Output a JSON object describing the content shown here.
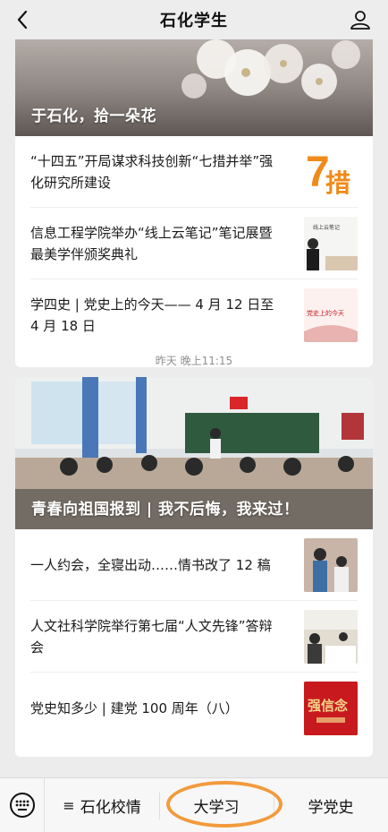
{
  "header": {
    "title": "石化学生"
  },
  "card1": {
    "hero_caption": "于石化，拾一朵花",
    "items": [
      {
        "text": "“十四五”开局谋求科技创新“七措并举”强化研究所建设",
        "thumb_text": "措"
      },
      {
        "text": "信息工程学院举办“线上云笔记”笔记展暨最美学伴颁奖典礼",
        "thumb_text": "线上云笔记"
      },
      {
        "text": "学四史 | 党史上的今天—— 4 月 12 日至 4 月 18 日",
        "thumb_text": "党史上的今天"
      }
    ]
  },
  "timestamp": "昨天 晚上11:15",
  "card2": {
    "hero_caption": "青春向祖国报到 | 我不后悔，我来过！",
    "items": [
      {
        "text": "一人约会，全寝出动……情书改了 12 稿"
      },
      {
        "text": "人文社科学院举行第七届“人文先锋”答辩会"
      },
      {
        "text": "党史知多少 | 建党 100 周年（八）",
        "thumb_text": "强信念"
      }
    ]
  },
  "bottom_menu": {
    "items": [
      {
        "label": "石化校情",
        "has_submenu": true
      },
      {
        "label": "大学习",
        "has_submenu": false
      },
      {
        "label": "学党史",
        "has_submenu": false
      }
    ],
    "highlight_color": "#f39a3c"
  },
  "colors": {
    "background": "#ececec",
    "card": "#ffffff",
    "thumb_orange": "#f08a1a",
    "thumb_red": "#c8191e"
  }
}
